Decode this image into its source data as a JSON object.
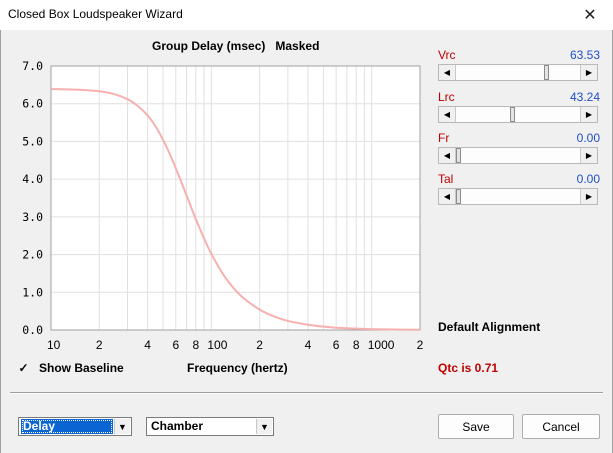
{
  "window": {
    "title": "Closed Box Loudspeaker Wizard",
    "close_glyph": "✕"
  },
  "chart_header": {
    "title": "Group Delay (msec)",
    "mode": "Masked"
  },
  "params": [
    {
      "name": "Vrc",
      "value": "63.53",
      "slider_fraction": 0.73
    },
    {
      "name": "Lrc",
      "value": "43.24",
      "slider_fraction": 0.45
    },
    {
      "name": "Fr",
      "value": "0.00",
      "slider_fraction": 0.0
    },
    {
      "name": "Tal",
      "value": "0.00",
      "slider_fraction": 0.0
    }
  ],
  "default_alignment": "Default Alignment",
  "qtc_text": "Qtc is 0.71",
  "show_baseline": {
    "label": "Show Baseline",
    "checked": true,
    "check_glyph": "✓"
  },
  "x_axis_title": "Frequency (hertz)",
  "view_select": {
    "value": "Delay",
    "selected": true
  },
  "chamber_select": {
    "value": "Chamber"
  },
  "buttons": {
    "save": "Save",
    "cancel": "Cancel"
  },
  "colors": {
    "curve": "#f6b0b0",
    "grid": "#e0e0e0",
    "param_label": "#c00000",
    "param_value": "#1f4fc9",
    "qtc": "#c00000",
    "selection": "#0a64d2"
  },
  "chart_data": {
    "type": "line",
    "title": "Group Delay (msec)",
    "xlabel": "Frequency (hertz)",
    "ylabel": "",
    "xscale": "log",
    "xlim": [
      10,
      2000
    ],
    "ylim": [
      0,
      7
    ],
    "y_ticks": [
      "0.0",
      "1.0",
      "2.0",
      "3.0",
      "4.0",
      "5.0",
      "6.0",
      "7.0"
    ],
    "x_tick_labels": [
      {
        "x": 10,
        "label": "10"
      },
      {
        "x": 20,
        "label": "2"
      },
      {
        "x": 40,
        "label": "4"
      },
      {
        "x": 60,
        "label": "6"
      },
      {
        "x": 80,
        "label": "8"
      },
      {
        "x": 100,
        "label": "100"
      },
      {
        "x": 200,
        "label": "2"
      },
      {
        "x": 400,
        "label": "4"
      },
      {
        "x": 600,
        "label": "6"
      },
      {
        "x": 800,
        "label": "8"
      },
      {
        "x": 1000,
        "label": "1000"
      },
      {
        "x": 2000,
        "label": "2"
      }
    ],
    "grid": true,
    "series": [
      {
        "x": [
          10,
          15,
          20,
          25,
          30,
          35,
          40,
          45,
          50,
          55,
          60,
          65,
          70,
          75,
          80,
          90,
          100,
          120,
          150,
          200,
          250,
          300,
          400,
          500,
          600,
          800,
          1000,
          1500,
          2000
        ],
        "y": [
          6.39,
          6.37,
          6.33,
          6.25,
          6.12,
          5.93,
          5.69,
          5.39,
          5.04,
          4.67,
          4.29,
          3.92,
          3.57,
          3.24,
          2.94,
          2.43,
          2.02,
          1.44,
          0.94,
          0.54,
          0.35,
          0.24,
          0.14,
          0.09,
          0.06,
          0.035,
          0.022,
          0.01,
          0.006
        ]
      }
    ]
  }
}
